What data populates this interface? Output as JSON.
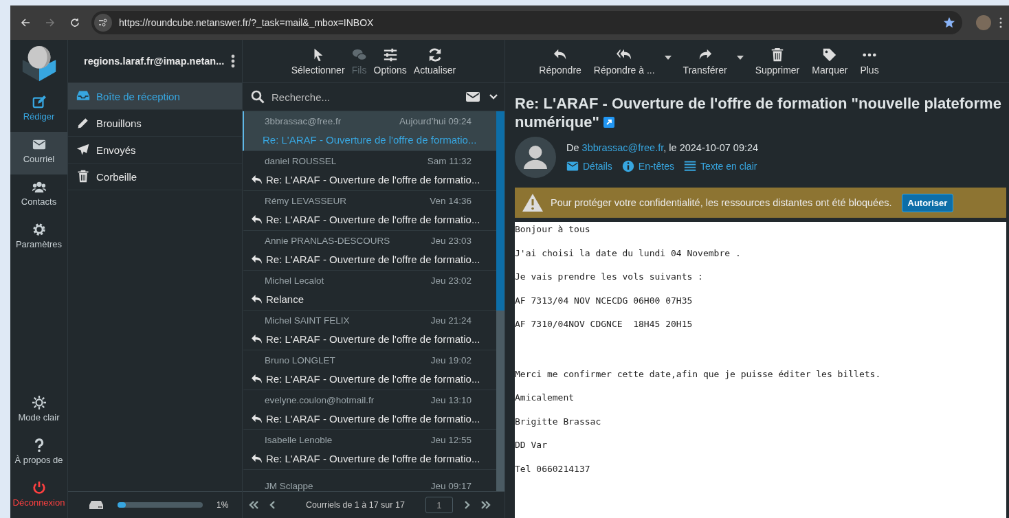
{
  "browser": {
    "url": "https://roundcube.netanswer.fr/?_task=mail&_mbox=INBOX"
  },
  "nav": [
    {
      "label": "Rédiger",
      "kind": "action",
      "selected": false
    },
    {
      "label": "Courriel",
      "kind": "item",
      "selected": true
    },
    {
      "label": "Contacts",
      "kind": "item",
      "selected": false
    },
    {
      "label": "Paramètres",
      "kind": "item",
      "selected": false
    }
  ],
  "nav_bottom": [
    {
      "label": "Mode clair",
      "kind": "item"
    },
    {
      "label": "À propos de",
      "kind": "item"
    },
    {
      "label": "Déconnexion",
      "kind": "logout"
    }
  ],
  "account": {
    "name": "regions.laraf.fr@imap.netan..."
  },
  "folders": [
    {
      "label": "Boîte de réception",
      "selected": true
    },
    {
      "label": "Brouillons",
      "selected": false
    },
    {
      "label": "Envoyés",
      "selected": false
    },
    {
      "label": "Corbeille",
      "selected": false
    }
  ],
  "quota": {
    "level": 0.1,
    "reading": "1%"
  },
  "list_toolbar": [
    {
      "label": "Sélectionner",
      "disabled": false
    },
    {
      "label": "Fils",
      "disabled": true
    },
    {
      "label": "Options",
      "disabled": false
    },
    {
      "label": "Actualiser",
      "disabled": false
    }
  ],
  "search": {
    "placeholder": "Recherche..."
  },
  "messages": [
    {
      "sender": "3bbrassac@free.fr",
      "date": "Aujourd’hui 09:24",
      "subject": "Re: L'ARAF - Ouverture de l'offre de formatio...",
      "selected": true,
      "unread": true
    },
    {
      "sender": "daniel ROUSSEL",
      "date": "Sam 11:32",
      "subject": "Re: L'ARAF - Ouverture de l'offre de formatio...",
      "selected": false,
      "replied": true,
      "unread": false
    },
    {
      "sender": "Rémy LEVASSEUR",
      "date": "Ven 14:36",
      "subject": "Re: L'ARAF - Ouverture de l'offre de formatio...",
      "selected": false,
      "replied": true,
      "unread": false
    },
    {
      "sender": "Annie PRANLAS-DESCOURS",
      "date": "Jeu 23:03",
      "subject": "Re: L'ARAF - Ouverture de l'offre de formatio...",
      "selected": false,
      "replied": true,
      "unread": false
    },
    {
      "sender": "Michel Lecalot",
      "date": "Jeu 23:02",
      "subject": "Relance",
      "selected": false,
      "replied": true,
      "unread": false
    },
    {
      "sender": "Michel SAINT FELIX",
      "date": "Jeu 21:24",
      "subject": "Re: L'ARAF - Ouverture de l'offre de formatio...",
      "selected": false,
      "replied": true,
      "unread": false
    },
    {
      "sender": "Bruno LONGLET",
      "date": "Jeu 19:02",
      "subject": "Re: L'ARAF - Ouverture de l'offre de formatio...",
      "selected": false,
      "replied": true,
      "unread": false
    },
    {
      "sender": "evelyne.coulon@hotmail.fr",
      "date": "Jeu 13:10",
      "subject": "Re: L'ARAF - Ouverture de l'offre de formatio...",
      "selected": false,
      "replied": true,
      "unread": false
    },
    {
      "sender": "Isabelle Lenoble",
      "date": "Jeu 12:55",
      "subject": "Re: L'ARAF - Ouverture de l'offre de formatio...",
      "selected": false,
      "replied": true,
      "unread": false
    },
    {
      "sender": "JM Sclappe",
      "date": "Jeu 09:17",
      "selected": false,
      "replied": false,
      "unread": false
    }
  ],
  "pagination": {
    "text": "Courriels de 1 à 17 sur 17",
    "page": "1"
  },
  "message_toolbar": [
    {
      "label": "Répondre",
      "menu": false
    },
    {
      "label": "Répondre à ...",
      "menu": true
    },
    {
      "label": "Transférer",
      "menu": true
    },
    {
      "label": "Supprimer",
      "menu": false
    },
    {
      "label": "Marquer",
      "menu": false
    },
    {
      "label": "Plus",
      "menu": false
    }
  ],
  "message": {
    "subject": "Re: L'ARAF - Ouverture de l'offre de formation \"nouvelle plateforme numérique\"",
    "from_prefix": "De",
    "from_email": "3bbrassac@free.fr",
    "from_suffix": ", le 2024-10-07 09:24",
    "links": [
      "Détails",
      "En-têtes",
      "Texte en clair"
    ],
    "notice": {
      "text": "Pour protéger votre confidentialité, les ressources distantes ont été bloquées.",
      "button": "Autoriser"
    },
    "body": [
      {
        "text": "Bonjour à tous",
        "gap_before": false
      },
      {
        "text": "J'ai choisi la date du lundi 04 Novembre .",
        "gap_before": false
      },
      {
        "text": "Je vais prendre les vols suivants :",
        "gap_before": false
      },
      {
        "text": "AF 7313/04 NOV NCECDG 06H00 07H35",
        "gap_before": false
      },
      {
        "text": "AF 7310/04NOV CDGNCE  18H45 20H15",
        "gap_before": false
      },
      {
        "text": "Merci me confirmer cette date,afin que je puisse éditer les billets.",
        "gap_before": true
      },
      {
        "text": "Amicalement",
        "gap_before": false
      },
      {
        "text": "Brigitte Brassac",
        "gap_before": false
      },
      {
        "text": "DD Var",
        "gap_before": false
      },
      {
        "text": "Tel 0660214137",
        "gap_before": false
      }
    ]
  }
}
